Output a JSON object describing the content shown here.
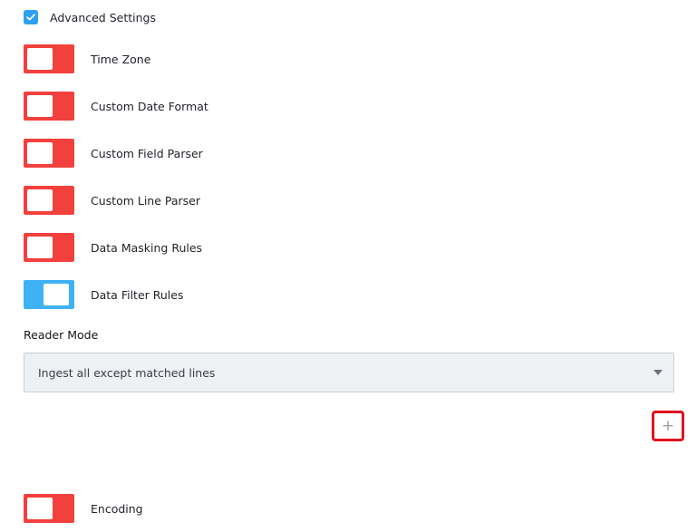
{
  "advanced_settings": {
    "label": "Advanced Settings",
    "checked": true,
    "checkbox_color": "#2f9ff0"
  },
  "toggles": [
    {
      "label": "Time Zone",
      "on": false
    },
    {
      "label": "Custom Date Format",
      "on": false
    },
    {
      "label": "Custom Field Parser",
      "on": false
    },
    {
      "label": "Custom Line Parser",
      "on": false
    },
    {
      "label": "Data Masking Rules",
      "on": false
    },
    {
      "label": "Data Filter Rules",
      "on": true
    },
    {
      "label": "Encoding",
      "on": false
    }
  ],
  "reader_mode": {
    "title": "Reader Mode",
    "selected": "Ingest all except matched lines"
  },
  "add_button": {
    "label": "+",
    "icon": "plus-icon"
  },
  "colors": {
    "toggle_off": "#f2413d",
    "toggle_on": "#3fb2f5",
    "highlight_border": "#e3101d"
  }
}
